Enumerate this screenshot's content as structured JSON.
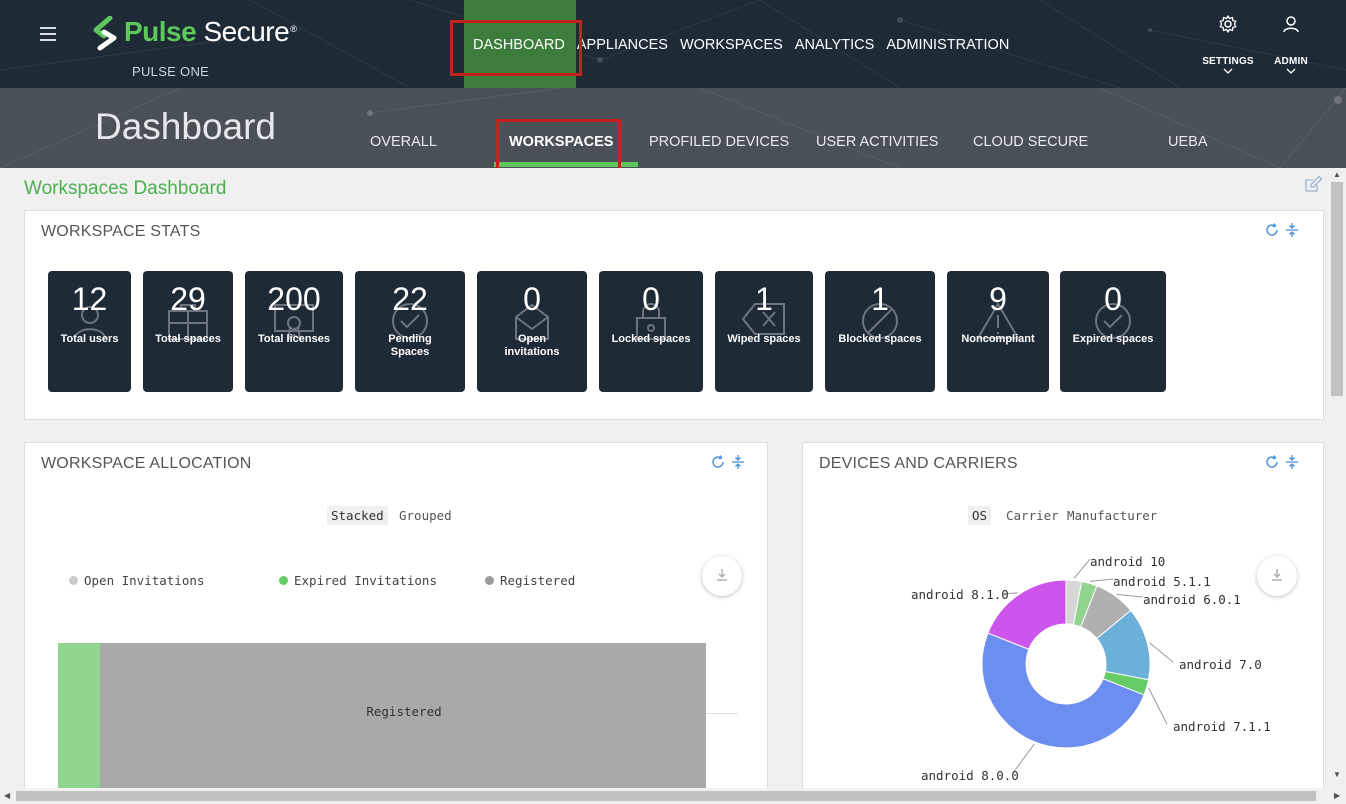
{
  "header": {
    "brand_pulse": "Pulse",
    "brand_secure": "Secure",
    "brand_mark": "®",
    "sub_brand": "PULSE ONE",
    "nav": [
      "DASHBOARD",
      "APPLIANCES",
      "WORKSPACES",
      "ANALYTICS",
      "ADMINISTRATION"
    ],
    "active_nav": "DASHBOARD",
    "settings_label": "SETTINGS",
    "admin_label": "ADMIN"
  },
  "subheader": {
    "title": "Dashboard",
    "tabs": [
      "OVERALL",
      "WORKSPACES",
      "PROFILED DEVICES",
      "USER ACTIVITIES",
      "CLOUD SECURE",
      "UEBA"
    ],
    "active_tab": "WORKSPACES"
  },
  "dashboard_title": "Workspaces Dashboard",
  "workspace_stats": {
    "title": "WORKSPACE STATS",
    "cards": [
      {
        "value": "12",
        "label": "Total users",
        "icon": "user-icon"
      },
      {
        "value": "29",
        "label": "Total spaces",
        "icon": "briefcase-icon"
      },
      {
        "value": "200",
        "label": "Total licenses",
        "icon": "certificate-icon"
      },
      {
        "value": "22",
        "label": "Pending Spaces",
        "icon": "check-circle-icon"
      },
      {
        "value": "0",
        "label": "Open invitations",
        "icon": "envelope-icon"
      },
      {
        "value": "0",
        "label": "Locked spaces",
        "icon": "lock-icon"
      },
      {
        "value": "1",
        "label": "Wiped spaces",
        "icon": "backspace-icon"
      },
      {
        "value": "1",
        "label": "Blocked spaces",
        "icon": "block-icon"
      },
      {
        "value": "9",
        "label": "Noncompliant",
        "icon": "warning-icon"
      },
      {
        "value": "0",
        "label": "Expired spaces",
        "icon": "check-circle-icon"
      }
    ]
  },
  "workspace_allocation": {
    "title": "WORKSPACE ALLOCATION",
    "toggle": [
      "Stacked",
      "Grouped"
    ],
    "selected_toggle": "Stacked"
  },
  "devices_carriers": {
    "title": "DEVICES AND CARRIERS",
    "toggle": [
      "OS",
      "Carrier",
      "Manufacturer"
    ],
    "selected_toggle": "OS"
  },
  "colors": {
    "accent_green": "#5cc85c",
    "header_dark": "#1f2a37",
    "highlight_red": "#c0231c"
  },
  "chart_data": [
    {
      "type": "bar",
      "orientation": "horizontal",
      "stacked": true,
      "series": [
        {
          "name": "Open Invitations",
          "values": [
            0
          ],
          "color": "#cccccc"
        },
        {
          "name": "Expired Invitations",
          "values": [
            1
          ],
          "color": "#90d490"
        },
        {
          "name": "Registered",
          "values": [
            14.5
          ],
          "color": "#a9a9a9"
        }
      ],
      "bar_label": "Registered",
      "legend_placement": "top"
    },
    {
      "type": "pie",
      "donut": true,
      "slices": [
        {
          "label": "android 10",
          "value": 3,
          "color": "#d6d6d6"
        },
        {
          "label": "android 5.1.1",
          "value": 3,
          "color": "#90d490"
        },
        {
          "label": "android 6.0.1",
          "value": 8,
          "color": "#b0b0b0"
        },
        {
          "label": "android 7.0",
          "value": 14,
          "color": "#6ab0d9"
        },
        {
          "label": "android 7.1.1",
          "value": 3,
          "color": "#66cc66"
        },
        {
          "label": "android 8.0.0",
          "value": 50,
          "color": "#6b8ef0"
        },
        {
          "label": "android 8.1.0",
          "value": 19,
          "color": "#cc55ee"
        }
      ]
    }
  ]
}
